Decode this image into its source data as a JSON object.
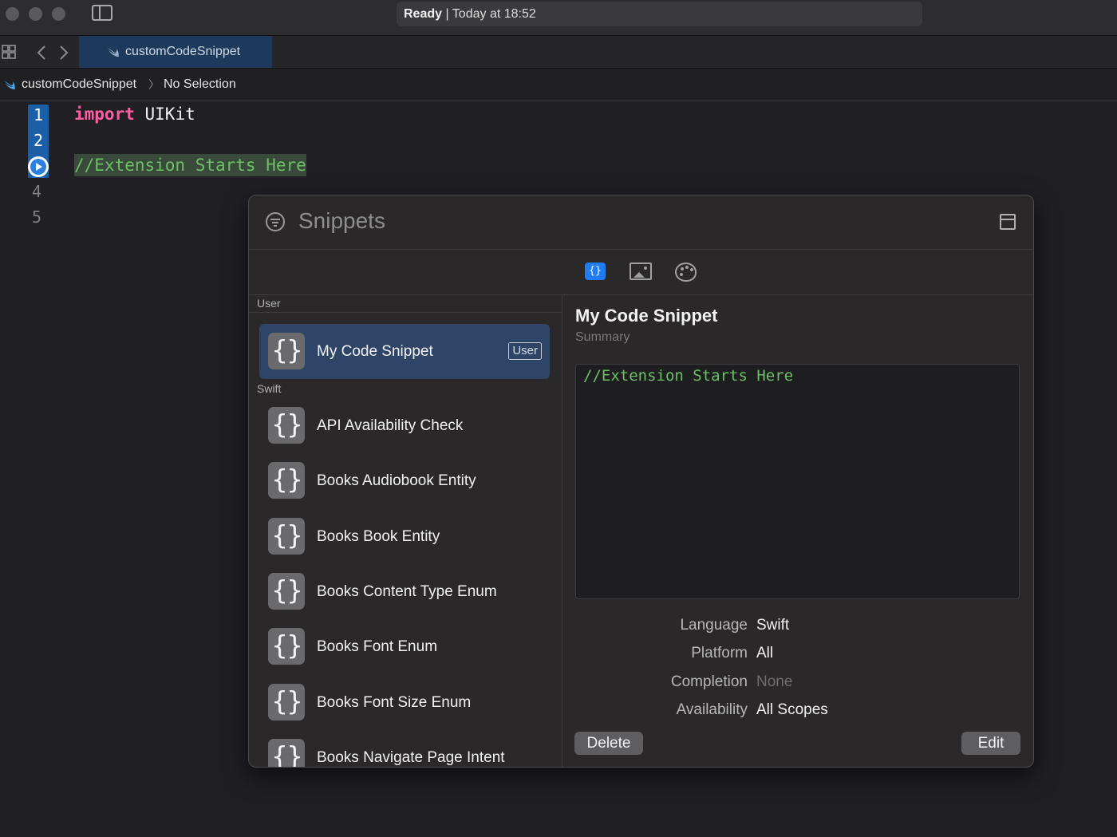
{
  "activity": {
    "status": "Ready",
    "separator": "|",
    "time": "Today at 18:52"
  },
  "tab": {
    "title": "customCodeSnippet"
  },
  "jumpbar": {
    "project": "customCodeSnippet",
    "chevron": "〉",
    "selection": "No Selection"
  },
  "editor": {
    "line_numbers": [
      "1",
      "2",
      "4",
      "5"
    ],
    "line1_keyword": "import",
    "line1_module": "UIKit",
    "line3_comment": "//Extension Starts Here"
  },
  "snippets": {
    "title": "Snippets",
    "user_section": "User",
    "swift_section": "Swift",
    "icon_glyph": "{}",
    "selected_item": {
      "name": "My Code Snippet",
      "badge": "User"
    },
    "items": [
      "API Availability Check",
      "Books Audiobook Entity",
      "Books Book Entity",
      "Books Content Type Enum",
      "Books Font Enum",
      "Books Font Size Enum",
      "Books Navigate Page Intent"
    ],
    "library_tabs": [
      "code-snippets-icon",
      "media-icon",
      "colors-icon"
    ],
    "detail": {
      "title": "My Code Snippet",
      "summary": "Summary",
      "code": "//Extension Starts Here",
      "language_label": "Language",
      "language_value": "Swift",
      "platform_label": "Platform",
      "platform_value": "All",
      "completion_label": "Completion",
      "completion_value": "None",
      "availability_label": "Availability",
      "availability_value": "All Scopes"
    },
    "delete_label": "Delete",
    "edit_label": "Edit"
  },
  "colors": {
    "keyword": "#fc5fa3",
    "comment": "#6dbf67",
    "accent": "#1f7cf5",
    "selection": "#2f4567"
  }
}
